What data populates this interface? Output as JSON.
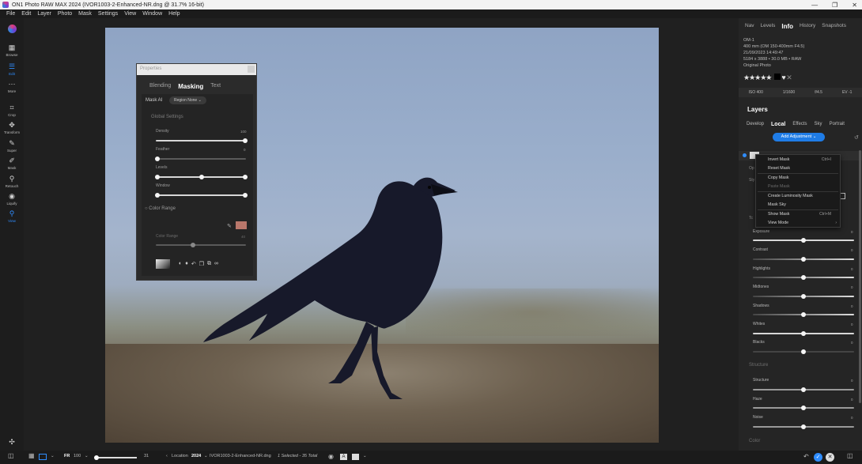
{
  "window": {
    "title": "ON1 Photo RAW MAX 2024 (IVOR1003-2-Enhanced-NR.dng @ 31.7% 16-bit)",
    "controls": [
      "—",
      "❐",
      "✕"
    ]
  },
  "menu": [
    "File",
    "Edit",
    "Layer",
    "Photo",
    "Mask",
    "Settings",
    "View",
    "Window",
    "Help"
  ],
  "tools": [
    {
      "label": "Browse",
      "icon": "grid-icon",
      "glyph": "▦"
    },
    {
      "label": "Edit",
      "icon": "sliders-icon",
      "glyph": "☰"
    },
    {
      "label": "More",
      "icon": "more-icon",
      "glyph": "⋯"
    },
    {
      "label": "Crop",
      "icon": "crop-icon",
      "glyph": "⌗"
    },
    {
      "label": "Transform",
      "icon": "transform-icon",
      "glyph": "✥"
    },
    {
      "label": "Super",
      "icon": "brush-icon",
      "glyph": "✎"
    },
    {
      "label": "Mask",
      "icon": "mask-brush-icon",
      "glyph": "✐"
    },
    {
      "label": "Retouch",
      "icon": "retouch-icon",
      "glyph": "⚲"
    },
    {
      "label": "Liquify",
      "icon": "liquify-icon",
      "glyph": "◉"
    },
    {
      "label": "View",
      "icon": "zoom-icon",
      "glyph": "⚲"
    }
  ],
  "properties": {
    "title": "Properties",
    "tabs": [
      "Blending",
      "Masking",
      "Text"
    ],
    "active_tab": "Masking",
    "mask_ai_label": "Mask AI",
    "region_label": "Region",
    "region_value": "None",
    "global_settings": "Global Settings",
    "density_label": "Density",
    "density_value": "100",
    "feather_label": "Feather",
    "feather_value": "0",
    "levels_label": "Levels",
    "window_label": "Window",
    "color_range_label": "Color Range",
    "color_range_slider_label": "Color Range",
    "color_range_value": "40",
    "swatch_color": "#b9776b"
  },
  "right_panel": {
    "tabs": [
      "Nav",
      "Levels",
      "Info",
      "History",
      "Snapshots"
    ],
    "active_tab": "Info",
    "info": {
      "camera": "OM-1",
      "lens": "400 mm (OM 150-400mm F4.5)",
      "date": "21/09/2023 14:49:47",
      "size": "5184 x 3888 • 30.0 MB • RAW",
      "type": "Original Photo"
    },
    "stars": "★★★★★",
    "exif": [
      "ISO 400",
      "1/1600",
      "f/4.5",
      "EV -1"
    ],
    "layers_title": "Layers",
    "layer_tabs": [
      "Develop",
      "Local",
      "Effects",
      "Sky",
      "Portrait"
    ],
    "active_layer_tab": "Local",
    "add_adjustment": "Add Adjustment",
    "tone_sliders": [
      {
        "label": "Exposure",
        "value": "0"
      },
      {
        "label": "Contrast",
        "value": "0"
      },
      {
        "label": "Highlights",
        "value": "0"
      },
      {
        "label": "Midtones",
        "value": "0"
      },
      {
        "label": "Shadows",
        "value": "0"
      },
      {
        "label": "Whites",
        "value": "0"
      },
      {
        "label": "Blacks",
        "value": "0"
      }
    ],
    "structure_section": "Structure",
    "structure_sliders": [
      {
        "label": "Structure",
        "value": "0"
      },
      {
        "label": "Haze",
        "value": "0"
      },
      {
        "label": "Noise",
        "value": "0"
      }
    ],
    "color_section": "Color",
    "partial_labels": [
      "Op",
      "Sty",
      "Tc"
    ]
  },
  "context_menu": [
    {
      "label": "Invert Mask",
      "shortcut": "Ctrl+I",
      "enabled": true
    },
    {
      "label": "Reset Mask",
      "shortcut": "",
      "enabled": true
    },
    {
      "label": "Copy Mask",
      "shortcut": "",
      "enabled": true
    },
    {
      "label": "Paste Mask",
      "shortcut": "",
      "enabled": false
    },
    {
      "label": "Create Luminosity Mask",
      "shortcut": "",
      "enabled": true
    },
    {
      "label": "Mask Sky",
      "shortcut": "",
      "enabled": true
    },
    {
      "label": "Show Mask",
      "shortcut": "Ctrl+M",
      "enabled": true
    },
    {
      "label": "View Mode",
      "shortcut": "›",
      "enabled": true
    }
  ],
  "bottom": {
    "fr_label": "FR",
    "fr_value": "100",
    "zoom_value": "31",
    "location_label": "Location",
    "location_value": "2024",
    "filename": "IVOR1003-2-Enhanced-NR.dng",
    "selection": "1 Selected - 35 Total"
  }
}
